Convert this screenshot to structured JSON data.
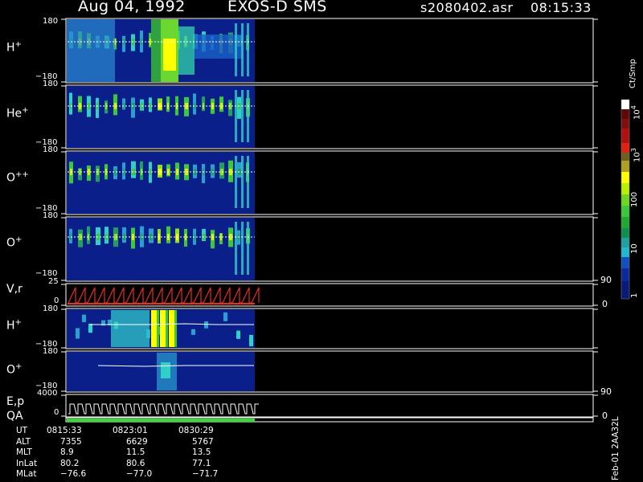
{
  "header": {
    "date": "Aug 04, 1992",
    "instrument": "EXOS-D SMS",
    "file": "s2080402.asr",
    "time": "08:15:33"
  },
  "chart_data": {
    "type": "heatmap",
    "panels": [
      {
        "label": "H",
        "sup": "+",
        "ylim": [
          -180,
          180
        ],
        "ticks": [
          "180",
          "−180"
        ]
      },
      {
        "label": "He",
        "sup": "+",
        "ylim": [
          -180,
          180
        ],
        "ticks": [
          "180",
          "−180"
        ]
      },
      {
        "label": "O",
        "sup": "++",
        "ylim": [
          -180,
          180
        ],
        "ticks": [
          "180",
          "−180"
        ]
      },
      {
        "label": "O",
        "sup": "+",
        "ylim": [
          -180,
          180
        ],
        "ticks": [
          "180",
          "−180"
        ]
      },
      {
        "label": "V,r",
        "sup": "",
        "ylim": [
          0,
          25
        ],
        "ticks": [
          "25",
          "0"
        ],
        "right_ticks": [
          "90",
          "0"
        ]
      },
      {
        "label": "H",
        "sup": "+",
        "ylim": [
          -180,
          180
        ],
        "ticks": [
          "180",
          "−180"
        ]
      },
      {
        "label": "O",
        "sup": "+",
        "ylim": [
          -180,
          180
        ],
        "ticks": [
          "180",
          "−180"
        ]
      },
      {
        "label": "E,p",
        "sup": "",
        "ylim": [
          0,
          4000
        ],
        "ticks": [
          "4000",
          "0"
        ],
        "right_ticks": [
          "90",
          "0"
        ]
      }
    ],
    "qa_label": "QA",
    "colorbar": {
      "title": "Ct/Smp",
      "scale": "log",
      "range": [
        1,
        10000
      ],
      "tick_labels": [
        "1",
        "10",
        "100",
        "10",
        "10"
      ],
      "tick_sups": [
        "",
        "",
        "",
        "3",
        "4"
      ]
    },
    "colors": {
      "low": "#0a1f8a",
      "mid": "#3cc83c",
      "high": "#ffff00",
      "red_trace": "#e83020",
      "qa_bar": "#33dd33"
    }
  },
  "footer": {
    "rows": [
      {
        "name": "UT",
        "v1": "0815:33",
        "v2": "0823:01",
        "v3": "0830:29"
      },
      {
        "name": "ALT",
        "v1": "7355",
        "v2": "6629",
        "v3": "5767"
      },
      {
        "name": "MLT",
        "v1": "8.9",
        "v2": "11.5",
        "v3": "13.5"
      },
      {
        "name": "InLat",
        "v1": "80.2",
        "v2": "80.6",
        "v3": "77.1"
      },
      {
        "name": "MLat",
        "v1": "−76.6",
        "v2": "−77.0",
        "v3": "−71.7"
      }
    ],
    "version": "Feb-01 2AA32L"
  }
}
